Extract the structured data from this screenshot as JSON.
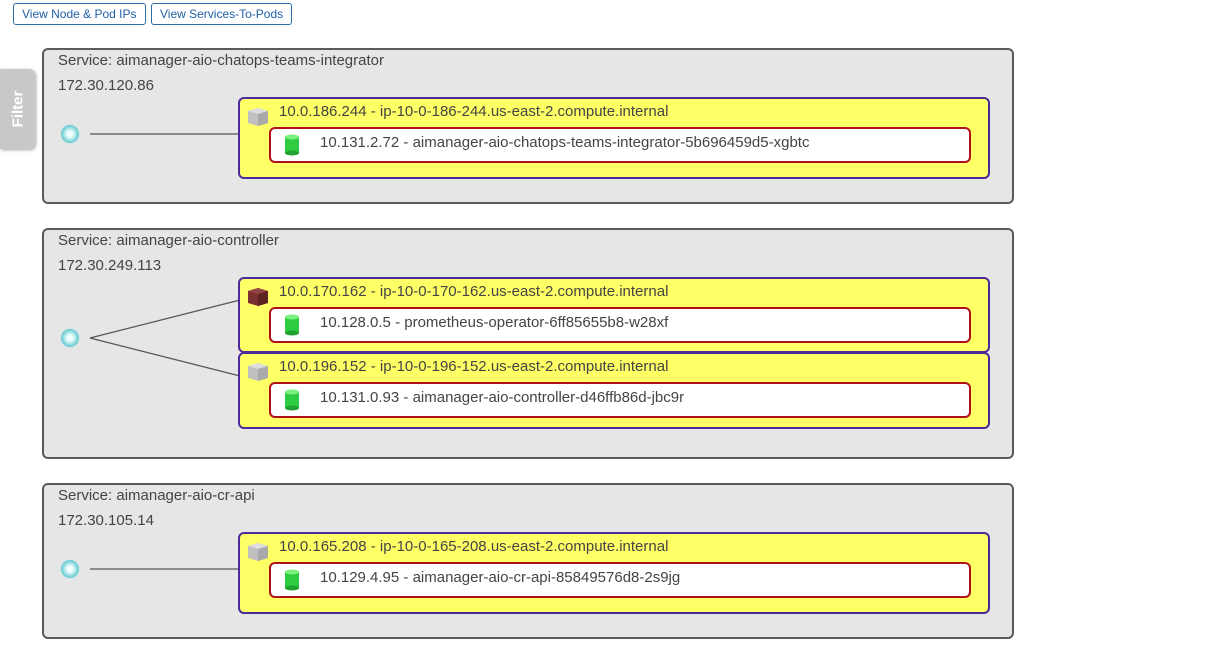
{
  "toolbar": {
    "view_node_pod_ips_label": "View Node & Pod IPs",
    "view_services_to_pods_label": "View Services-To-Pods"
  },
  "filter": {
    "label": "Filter"
  },
  "colors": {
    "service_bg": "#e6e6e6",
    "service_border": "#5a5a5a",
    "node_bg": "#ffff66",
    "node_border": "#4b2b9a",
    "pod_border": "#b0101a",
    "pod_icon": "#2ecc40",
    "node_icon_default": "#c0c0c0",
    "node_icon_highlight": "#7a3030",
    "service_icon": "#7ad3d8",
    "button_text": "#1f5fa8"
  },
  "services": [
    {
      "name": "Service: aimanager-aio-chatops-teams-integrator",
      "ip": "172.30.120.86",
      "icon": "service-node-icon",
      "nodes": [
        {
          "label": "10.0.186.244 - ip-10-0-186-244.us-east-2.compute.internal",
          "icon": "server-cube-icon",
          "highlight": false,
          "pod": {
            "label": "10.131.2.72 - aimanager-aio-chatops-teams-integrator-5b696459d5-xgbtc",
            "icon": "pod-cylinder-icon"
          }
        }
      ]
    },
    {
      "name": "Service: aimanager-aio-controller",
      "ip": "172.30.249.113",
      "icon": "service-node-icon",
      "nodes": [
        {
          "label": "10.0.170.162 - ip-10-0-170-162.us-east-2.compute.internal",
          "icon": "server-cube-icon",
          "highlight": true,
          "pod": {
            "label": "10.128.0.5 - prometheus-operator-6ff85655b8-w28xf",
            "icon": "pod-cylinder-icon"
          }
        },
        {
          "label": "10.0.196.152 - ip-10-0-196-152.us-east-2.compute.internal",
          "icon": "server-cube-icon",
          "highlight": false,
          "pod": {
            "label": "10.131.0.93 - aimanager-aio-controller-d46ffb86d-jbc9r",
            "icon": "pod-cylinder-icon"
          }
        }
      ]
    },
    {
      "name": "Service: aimanager-aio-cr-api",
      "ip": "172.30.105.14",
      "icon": "service-node-icon",
      "nodes": [
        {
          "label": "10.0.165.208 - ip-10-0-165-208.us-east-2.compute.internal",
          "icon": "server-cube-icon",
          "highlight": false,
          "pod": {
            "label": "10.129.4.95 - aimanager-aio-cr-api-85849576d8-2s9jg",
            "icon": "pod-cylinder-icon"
          }
        }
      ]
    }
  ]
}
